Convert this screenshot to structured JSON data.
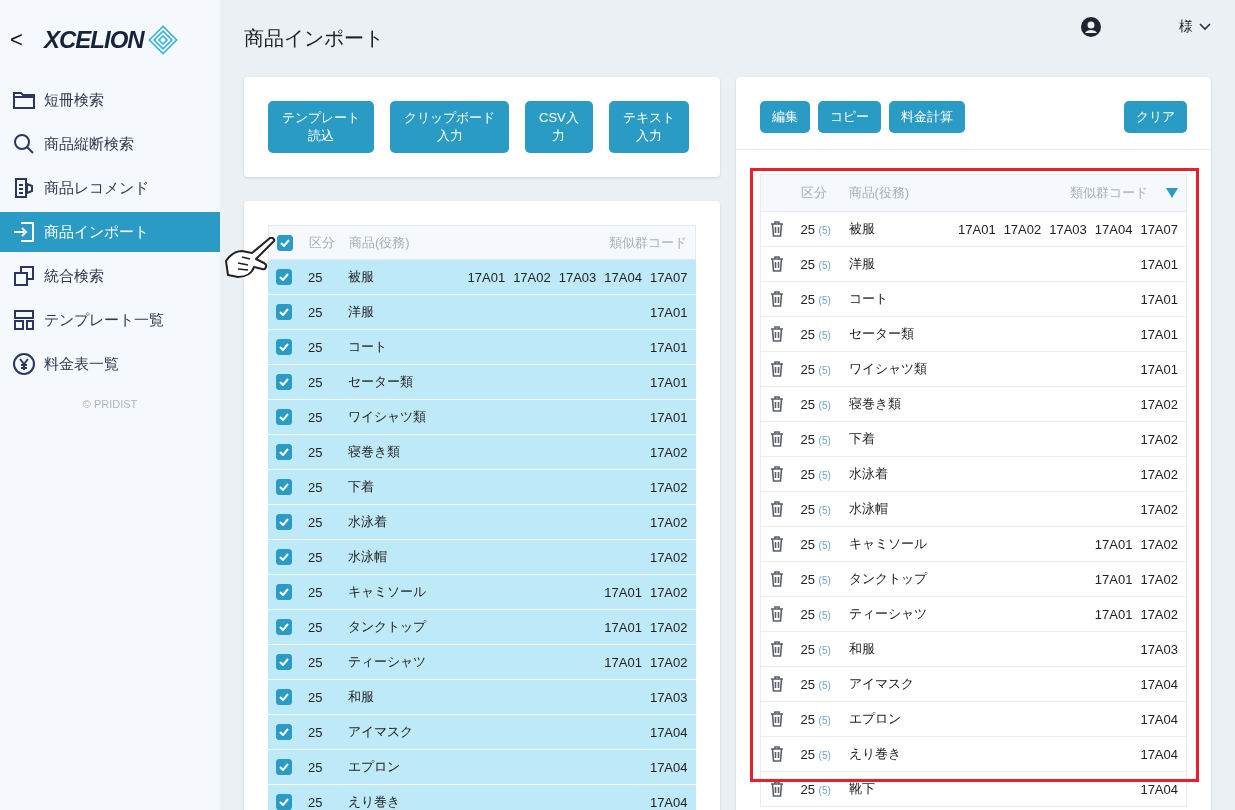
{
  "sidebar": {
    "back": "<",
    "logo": "XCELION",
    "items": [
      {
        "label": "短冊検索",
        "selected": false
      },
      {
        "label": "商品縦断検索",
        "selected": false
      },
      {
        "label": "商品レコメンド",
        "selected": false
      },
      {
        "label": "商品インポート",
        "selected": true
      },
      {
        "label": "統合検索",
        "selected": false
      },
      {
        "label": "テンプレート一覧",
        "selected": false
      },
      {
        "label": "料金表一覧",
        "selected": false
      }
    ],
    "copyright": "© PRIDIST"
  },
  "header": {
    "title": "商品インポート",
    "user": "様"
  },
  "import_buttons": [
    [
      "テンプレート",
      "読込"
    ],
    [
      "クリップボード",
      "入力"
    ],
    [
      "CSV入",
      "力"
    ],
    [
      "テキスト",
      "入力"
    ]
  ],
  "left_table": {
    "all_checked": true,
    "columns": [
      "区分",
      "商品(役務)",
      "類似群コード"
    ],
    "rows": [
      {
        "checked": true,
        "class": "25",
        "name": "被服",
        "codes": [
          "17A01",
          "17A02",
          "17A03",
          "17A04",
          "17A07"
        ]
      },
      {
        "checked": true,
        "class": "25",
        "name": "洋服",
        "codes": [
          "17A01"
        ]
      },
      {
        "checked": true,
        "class": "25",
        "name": "コート",
        "codes": [
          "17A01"
        ]
      },
      {
        "checked": true,
        "class": "25",
        "name": "セーター類",
        "codes": [
          "17A01"
        ]
      },
      {
        "checked": true,
        "class": "25",
        "name": "ワイシャツ類",
        "codes": [
          "17A01"
        ]
      },
      {
        "checked": true,
        "class": "25",
        "name": "寝巻き類",
        "codes": [
          "17A02"
        ]
      },
      {
        "checked": true,
        "class": "25",
        "name": "下着",
        "codes": [
          "17A02"
        ]
      },
      {
        "checked": true,
        "class": "25",
        "name": "水泳着",
        "codes": [
          "17A02"
        ]
      },
      {
        "checked": true,
        "class": "25",
        "name": "水泳帽",
        "codes": [
          "17A02"
        ]
      },
      {
        "checked": true,
        "class": "25",
        "name": "キャミソール",
        "codes": [
          "17A01",
          "17A02"
        ]
      },
      {
        "checked": true,
        "class": "25",
        "name": "タンクトップ",
        "codes": [
          "17A01",
          "17A02"
        ]
      },
      {
        "checked": true,
        "class": "25",
        "name": "ティーシャツ",
        "codes": [
          "17A01",
          "17A02"
        ]
      },
      {
        "checked": true,
        "class": "25",
        "name": "和服",
        "codes": [
          "17A03"
        ]
      },
      {
        "checked": true,
        "class": "25",
        "name": "アイマスク",
        "codes": [
          "17A04"
        ]
      },
      {
        "checked": true,
        "class": "25",
        "name": "エプロン",
        "codes": [
          "17A04"
        ]
      },
      {
        "checked": true,
        "class": "25",
        "name": "えり巻き",
        "codes": [
          "17A04"
        ]
      }
    ]
  },
  "right_buttons": [
    "編集",
    "コピー",
    "料金計算"
  ],
  "clear_button": "クリア",
  "right_table": {
    "columns": [
      "区分",
      "商品(役務)",
      "類似群コード"
    ],
    "rows": [
      {
        "class": "25",
        "count": "(5)",
        "name": "被服",
        "codes": [
          "17A01",
          "17A02",
          "17A03",
          "17A04",
          "17A07"
        ]
      },
      {
        "class": "25",
        "count": "(5)",
        "name": "洋服",
        "codes": [
          "17A01"
        ]
      },
      {
        "class": "25",
        "count": "(5)",
        "name": "コート",
        "codes": [
          "17A01"
        ]
      },
      {
        "class": "25",
        "count": "(5)",
        "name": "セーター類",
        "codes": [
          "17A01"
        ]
      },
      {
        "class": "25",
        "count": "(5)",
        "name": "ワイシャツ類",
        "codes": [
          "17A01"
        ]
      },
      {
        "class": "25",
        "count": "(5)",
        "name": "寝巻き類",
        "codes": [
          "17A02"
        ]
      },
      {
        "class": "25",
        "count": "(5)",
        "name": "下着",
        "codes": [
          "17A02"
        ]
      },
      {
        "class": "25",
        "count": "(5)",
        "name": "水泳着",
        "codes": [
          "17A02"
        ]
      },
      {
        "class": "25",
        "count": "(5)",
        "name": "水泳帽",
        "codes": [
          "17A02"
        ]
      },
      {
        "class": "25",
        "count": "(5)",
        "name": "キャミソール",
        "codes": [
          "17A01",
          "17A02"
        ]
      },
      {
        "class": "25",
        "count": "(5)",
        "name": "タンクトップ",
        "codes": [
          "17A01",
          "17A02"
        ]
      },
      {
        "class": "25",
        "count": "(5)",
        "name": "ティーシャツ",
        "codes": [
          "17A01",
          "17A02"
        ]
      },
      {
        "class": "25",
        "count": "(5)",
        "name": "和服",
        "codes": [
          "17A03"
        ]
      },
      {
        "class": "25",
        "count": "(5)",
        "name": "アイマスク",
        "codes": [
          "17A04"
        ]
      },
      {
        "class": "25",
        "count": "(5)",
        "name": "エプロン",
        "codes": [
          "17A04"
        ]
      },
      {
        "class": "25",
        "count": "(5)",
        "name": "えり巻き",
        "codes": [
          "17A04"
        ]
      },
      {
        "class": "25",
        "count": "(5)",
        "name": "靴下",
        "codes": [
          "17A04"
        ]
      }
    ]
  }
}
